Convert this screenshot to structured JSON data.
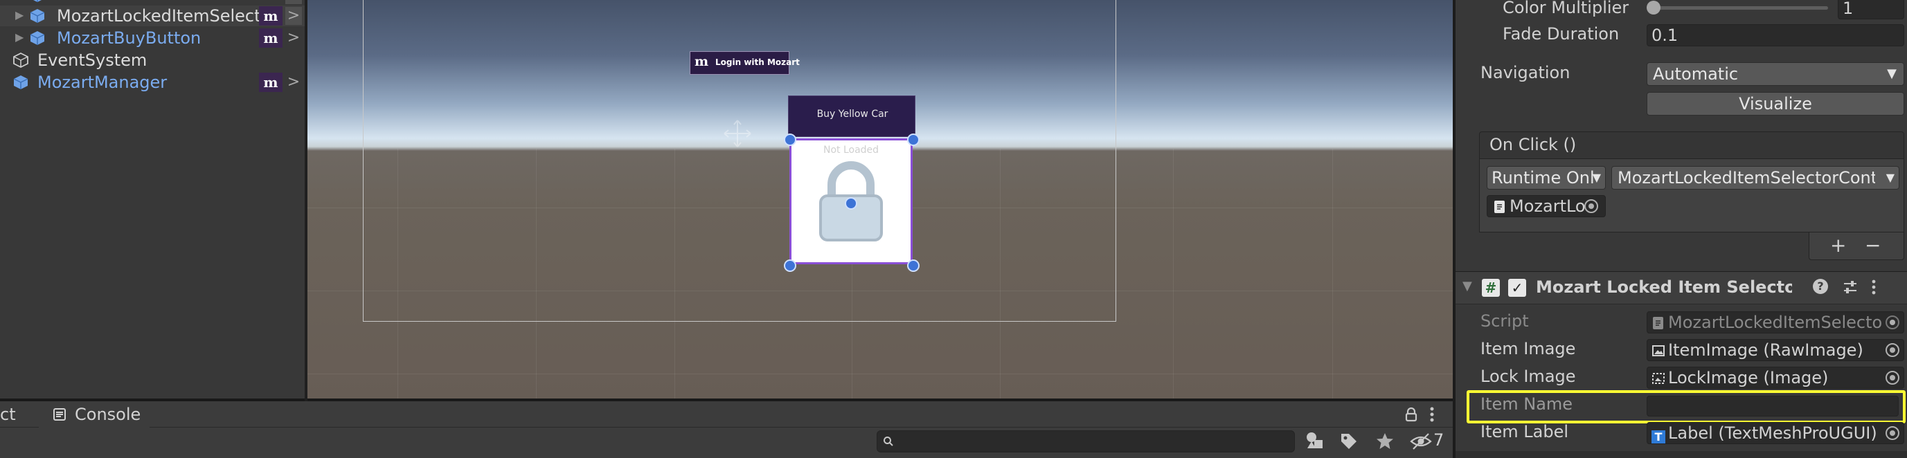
{
  "hierarchy": {
    "items": [
      {
        "label": "MozartLockedItemSelector",
        "badge": "m",
        "chevron": ">"
      },
      {
        "label": "MozartBuyButton",
        "badge": "m",
        "chevron": ">"
      },
      {
        "label": "EventSystem"
      },
      {
        "label": "MozartManager",
        "badge": "m",
        "chevron": ">"
      }
    ]
  },
  "scene": {
    "login_button": {
      "logo": "m",
      "label": "Login with Mozart"
    },
    "buy_button": {
      "label": "Buy Yellow Car"
    },
    "item_card": {
      "status": "Not Loaded"
    }
  },
  "bottom": {
    "project_tab": "ct",
    "console_tab": "Console",
    "hidden_count": "7",
    "lock_icon": "lock-icon",
    "menu_icon": "kebab-menu-icon"
  },
  "inspector": {
    "color_multiplier": {
      "label": "Color Multiplier",
      "value": "1",
      "slider_fraction": 0.0
    },
    "fade_duration": {
      "label": "Fade Duration",
      "value": "0.1"
    },
    "navigation": {
      "label": "Navigation",
      "value": "Automatic",
      "visualize": "Visualize"
    },
    "on_click": {
      "header": "On Click ()",
      "runtime": "Runtime Onl",
      "function": "MozartLockedItemSelectorCont",
      "object": "MozartLo",
      "add": "+",
      "remove": "−"
    },
    "component": {
      "title": "Mozart Locked Item Selector Cont",
      "enabled": true,
      "fields": [
        {
          "label": "Script",
          "value": "MozartLockedItemSelecto",
          "dim": true
        },
        {
          "label": "Item Image",
          "value": "ItemImage (RawImage)"
        },
        {
          "label": "Lock Image",
          "value": "LockImage (Image)"
        },
        {
          "label": "Item Name",
          "value": ""
        },
        {
          "label": "Item Label",
          "value": "Label (TextMeshProUGUI)"
        }
      ]
    }
  },
  "colors": {
    "highlight": "#ffff33",
    "brand": "#2a1d4c",
    "blue_label": "#7bacf0",
    "selection": "#8a4fd6"
  }
}
